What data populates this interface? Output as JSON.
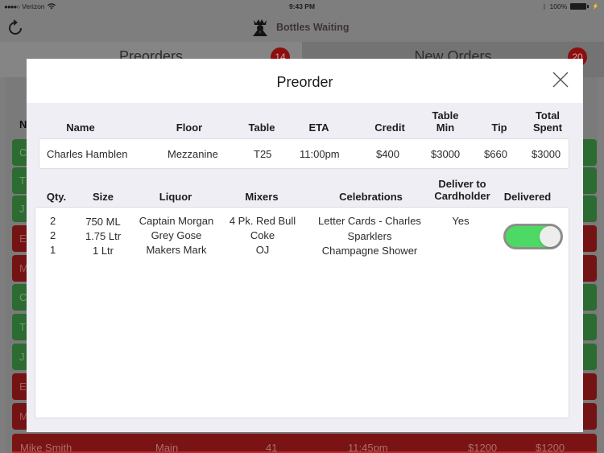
{
  "status_bar": {
    "carrier": "Verizon",
    "time": "9:43 PM",
    "battery": "100%"
  },
  "nav": {
    "title": "Bottles Waiting",
    "refresh_icon": "refresh-icon",
    "logo_icon": "crowned-bouncer-logo"
  },
  "tabs": [
    {
      "label": "Preorders",
      "badge": "14"
    },
    {
      "label": "New Orders",
      "badge": "20"
    }
  ],
  "list": {
    "header_initial": "N",
    "rows": [
      {
        "status": "green",
        "initial": "C"
      },
      {
        "status": "green",
        "initial": "T"
      },
      {
        "status": "green",
        "initial": "J"
      },
      {
        "status": "red",
        "initial": "E"
      },
      {
        "status": "red",
        "initial": "M"
      },
      {
        "status": "green",
        "initial": "C"
      },
      {
        "status": "green",
        "initial": "T"
      },
      {
        "status": "green",
        "initial": "J"
      },
      {
        "status": "red",
        "initial": "E"
      },
      {
        "status": "red",
        "initial": "M"
      }
    ],
    "last_row": {
      "name": "Mike Smith",
      "floor": "Main",
      "table": "41",
      "eta": "11:45pm",
      "table_min": "$1200",
      "total_spent": "$1200"
    }
  },
  "modal": {
    "title": "Preorder",
    "close_icon": "close-icon",
    "info_headers": {
      "name": "Name",
      "floor": "Floor",
      "table": "Table",
      "eta": "ETA",
      "credit": "Credit",
      "table_min_1": "Table",
      "table_min_2": "Min",
      "tip": "Tip",
      "total_spent_1": "Total",
      "total_spent_2": "Spent"
    },
    "info": {
      "name": "Charles Hamblen",
      "floor": "Mezzanine",
      "table": "T25",
      "eta": "11:00pm",
      "credit": "$400",
      "table_min": "$3000",
      "tip": "$660",
      "total_spent": "$3000"
    },
    "item_headers": {
      "qty": "Qty.",
      "size": "Size",
      "liquor": "Liquor",
      "mixers": "Mixers",
      "celebrations": "Celebrations",
      "deliver_1": "Deliver to",
      "deliver_2": "Cardholder",
      "delivered": "Delivered"
    },
    "items": [
      {
        "qty": "2",
        "size": "750 ML",
        "liquor": "Captain Morgan",
        "mixer": "4 Pk. Red Bull",
        "celebration": "Letter Cards - Charles"
      },
      {
        "qty": "2",
        "size": "1.75 Ltr",
        "liquor": "Grey Gose",
        "mixer": "Coke",
        "celebration": "Sparklers"
      },
      {
        "qty": "1",
        "size": "1 Ltr",
        "liquor": "Makers Mark",
        "mixer": "OJ",
        "celebration": "Champagne Shower"
      }
    ],
    "deliver_to_cardholder": "Yes",
    "delivered": true,
    "colors": {
      "toggle_on": "#4cd964",
      "badge": "#8c0e0e",
      "row_green": "#2c6b32",
      "row_red": "#741313"
    }
  }
}
